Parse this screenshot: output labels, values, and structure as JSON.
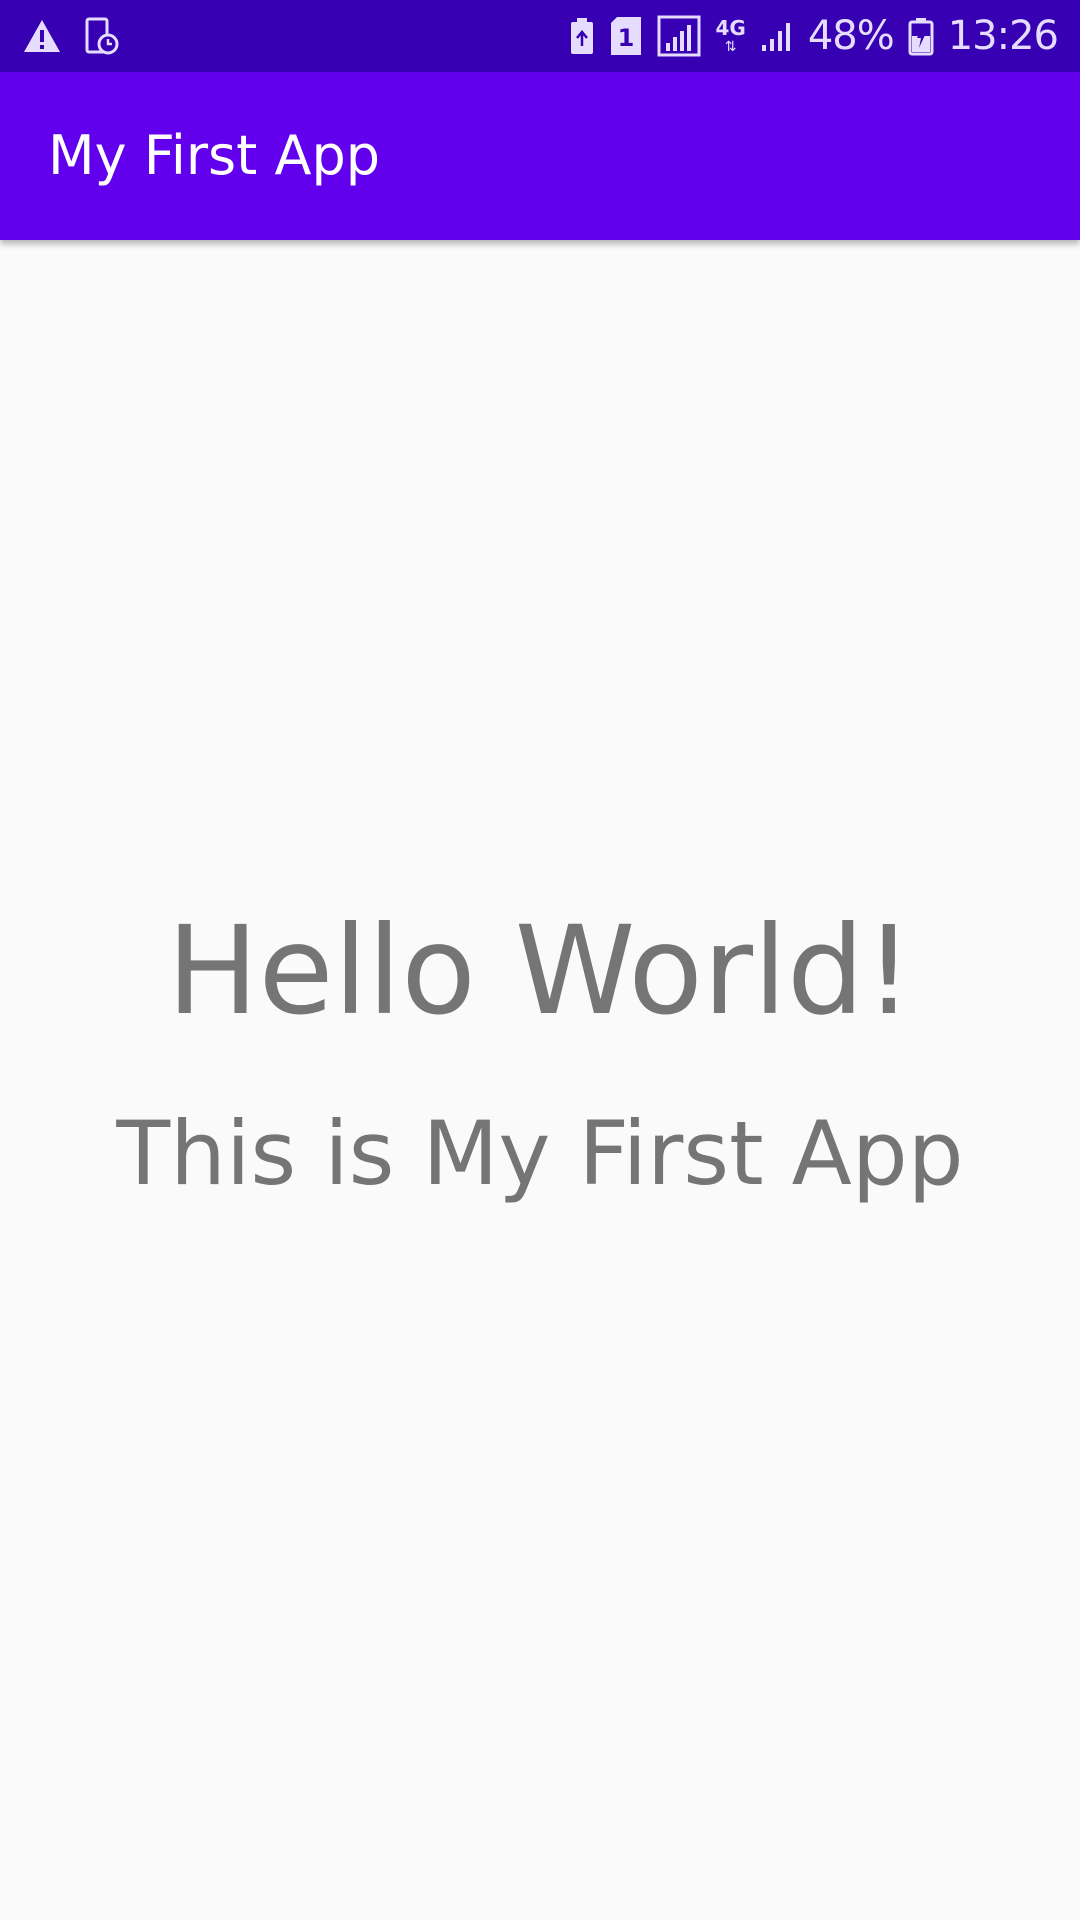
{
  "status_bar": {
    "left_icons": [
      "warning-icon",
      "device-schedule-icon"
    ],
    "sim_badge": "1",
    "network_type": "4G",
    "battery_percent": "48%",
    "time": "13:26"
  },
  "app_bar": {
    "title": "My First App"
  },
  "main": {
    "heading": "Hello World!",
    "subtitle": "This is My First App"
  },
  "colors": {
    "status_bar": "#3700b3",
    "app_bar": "#6200ee",
    "background": "#fafafa",
    "text": "#757575"
  }
}
